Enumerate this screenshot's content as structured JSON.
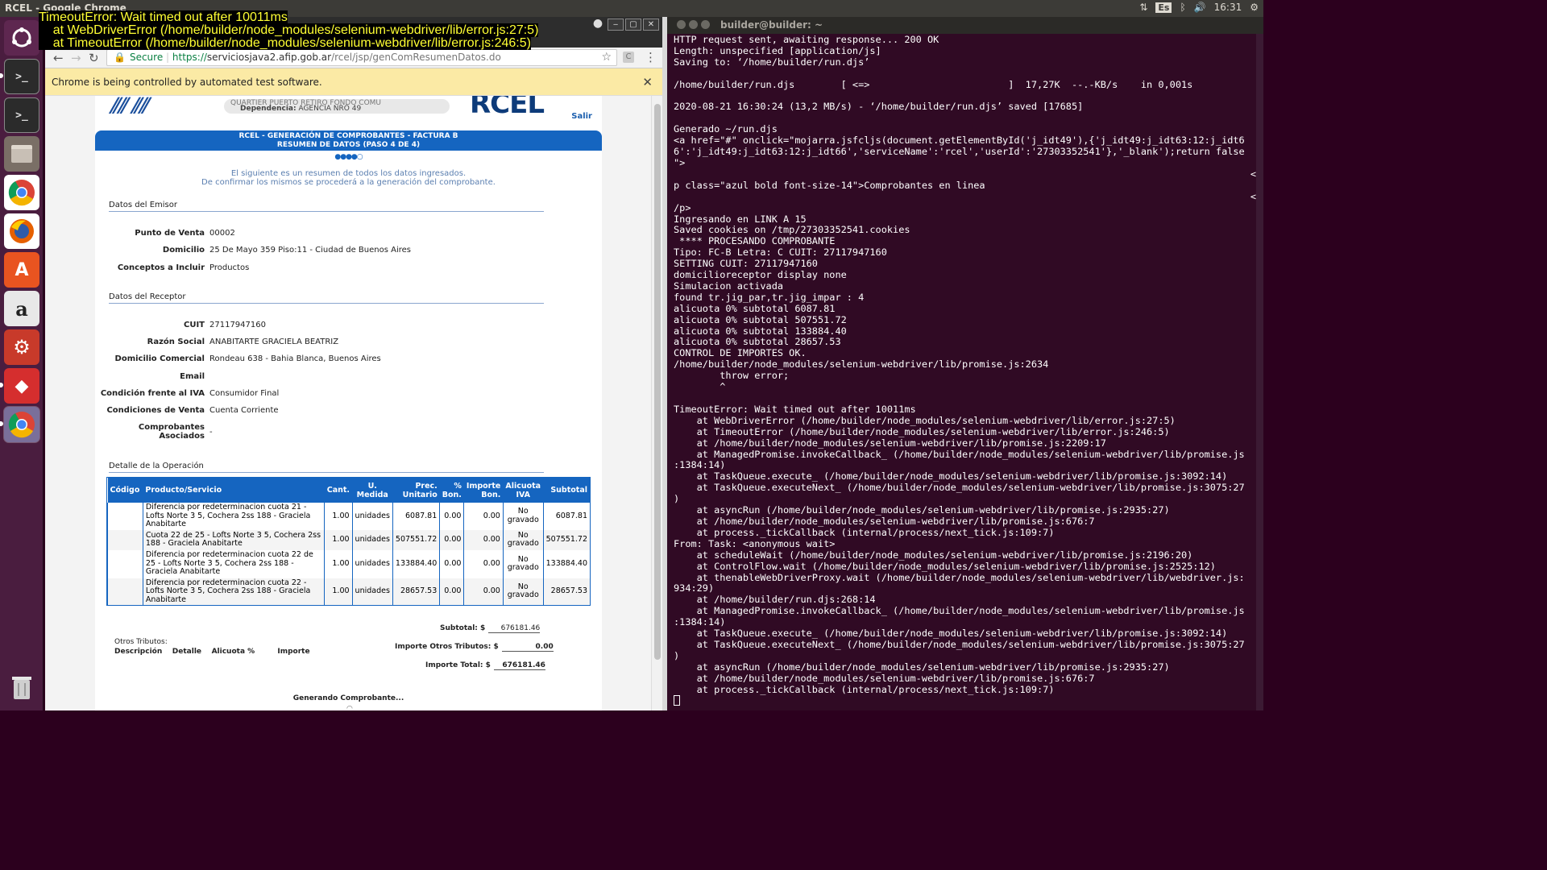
{
  "topbar": {
    "title": "RCEL - Google Chrome",
    "lang": "Es",
    "time": "16:31"
  },
  "error_overlay": [
    "TimeoutError: Wait timed out after 10011ms",
    "    at WebDriverError (/home/builder/node_modules/selenium-webdriver/lib/error.js:27:5)",
    "    at TimeoutError (/home/builder/node_modules/selenium-webdriver/lib/error.js:246:5)"
  ],
  "browser": {
    "secure_label": "Secure",
    "url_scheme": "https://",
    "url_host": "serviciosjava2.afip.gob.ar",
    "url_path": "/rcel/jsp/genComResumenDatos.do",
    "infobar": "Chrome is being controlled by automated test software."
  },
  "rcel": {
    "header_faded": "QUARTIER PUERTO RETIRO FONDO COMU",
    "dependencia_label": "Dependencia:",
    "dependencia": "AGENCIA NRO 49",
    "brand": "RCEL",
    "salir": "Salir",
    "band_title": "RCEL - GENERACIÓN DE COMPROBANTES - FACTURA B",
    "band_sub": "RESUMEN DE DATOS (PASO 4 DE 4)",
    "step_dots": "●●●●○",
    "intro_1": "El siguiente es un resumen de todos los datos ingresados.",
    "intro_2": "De confirmar los mismos se procederá a la generación del comprobante.",
    "emisor_title": "Datos del Emisor",
    "emisor": [
      {
        "label": "Punto de Venta",
        "value": "00002"
      },
      {
        "label": "Domicilio",
        "value": "25 De Mayo 359 Piso:11 - Ciudad de Buenos Aires"
      },
      {
        "label": "Conceptos a Incluir",
        "value": "Productos"
      }
    ],
    "receptor_title": "Datos del Receptor",
    "receptor": [
      {
        "label": "CUIT",
        "value": "27117947160"
      },
      {
        "label": "Razón Social",
        "value": "ANABITARTE GRACIELA BEATRIZ"
      },
      {
        "label": "Domicilio Comercial",
        "value": "Rondeau 638 - Bahia Blanca, Buenos Aires"
      },
      {
        "label": "Email",
        "value": ""
      },
      {
        "label": "Condición frente al IVA",
        "value": "Consumidor Final"
      },
      {
        "label": "Condiciones de Venta",
        "value": "Cuenta Corriente"
      }
    ],
    "asociados_label_1": "Comprobantes",
    "asociados_label_2": "Asociados",
    "asociados_value": "-",
    "detalle_title": "Detalle de la Operación",
    "columns": [
      "Código",
      "Producto/Servicio",
      "Cant.",
      "U. Medida",
      "Prec. Unitario",
      "% Bon.",
      "Importe Bon.",
      "Alicuota IVA",
      "Subtotal"
    ],
    "items": [
      {
        "codigo": "",
        "producto": "Diferencia por redeterminacion cuota 21 - Lofts Norte 3 5, Cochera 2ss 188 - Graciela Anabitarte",
        "cant": "1.00",
        "medida": "unidades",
        "precio": "6087.81",
        "bon": "0.00",
        "imp_bon": "0.00",
        "iva": "No gravado",
        "subtotal": "6087.81"
      },
      {
        "codigo": "",
        "producto": "Cuota 22 de 25 - Lofts Norte 3 5, Cochera 2ss 188 - Graciela Anabitarte",
        "cant": "1.00",
        "medida": "unidades",
        "precio": "507551.72",
        "bon": "0.00",
        "imp_bon": "0.00",
        "iva": "No gravado",
        "subtotal": "507551.72"
      },
      {
        "codigo": "",
        "producto": "Diferencia por redeterminacion cuota 22 de 25 - Lofts Norte 3 5, Cochera 2ss 188 - Graciela Anabitarte",
        "cant": "1.00",
        "medida": "unidades",
        "precio": "133884.40",
        "bon": "0.00",
        "imp_bon": "0.00",
        "iva": "No gravado",
        "subtotal": "133884.40"
      },
      {
        "codigo": "",
        "producto": "Diferencia por redeterminacion cuota 22 - Lofts Norte 3 5, Cochera 2ss 188 - Graciela Anabitarte",
        "cant": "1.00",
        "medida": "unidades",
        "precio": "28657.53",
        "bon": "0.00",
        "imp_bon": "0.00",
        "iva": "No gravado",
        "subtotal": "28657.53"
      }
    ],
    "subtotal_label": "Subtotal: $",
    "subtotal": "676181.46",
    "otros_tributos_title": "Otros Tributos:",
    "otros_cols": [
      "Descripción",
      "Detalle",
      "Alicuota %",
      "Importe"
    ],
    "otros_label": "Importe Otros Tributos: $",
    "otros_value": "0.00",
    "total_label": "Importe Total: $",
    "total": "676181.46",
    "generando": "Generando Comprobante..."
  },
  "terminal": {
    "title": "builder@builder: ~",
    "lines": [
      "HTTP request sent, awaiting response... 200 OK",
      "Length: unspecified [application/js]",
      "Saving to: ‘/home/builder/run.djs’",
      "",
      "/home/builder/run.djs        [ <=>                        ]  17,27K  --.-KB/s    in 0,001s",
      "",
      "2020-08-21 16:30:24 (13,2 MB/s) - ‘/home/builder/run.djs’ saved [17685]",
      "",
      "Generado ~/run.djs",
      "<a href=\"#\" onclick=\"mojarra.jsfcljs(document.getElementById('j_idt49'),{'j_idt49:j_idt63:12:j_idt6",
      "6':'j_idt49:j_idt63:12:j_idt66','serviceName':'rcel','userId':'27303352541'},'_blank');return false",
      "\">",
      "                                                                                                    <",
      "p class=\"azul bold font-size-14\">Comprobantes en linea",
      "                                                                                                    <",
      "/p>",
      "Ingresando en LINK A 15",
      "Saved cookies on /tmp/27303352541.cookies",
      " **** PROCESANDO COMPROBANTE",
      "Tipo: FC-B Letra: C CUIT: 27117947160",
      "SETTING CUIT: 27117947160",
      "domicilioreceptor display none",
      "Simulacion activada",
      "found tr.jig_par,tr.jig_impar : 4",
      "alicuota 0% subtotal 6087.81",
      "alicuota 0% subtotal 507551.72",
      "alicuota 0% subtotal 133884.40",
      "alicuota 0% subtotal 28657.53",
      "CONTROL DE IMPORTES OK.",
      "/home/builder/node_modules/selenium-webdriver/lib/promise.js:2634",
      "        throw error;",
      "        ^",
      "",
      "TimeoutError: Wait timed out after 10011ms",
      "    at WebDriverError (/home/builder/node_modules/selenium-webdriver/lib/error.js:27:5)",
      "    at TimeoutError (/home/builder/node_modules/selenium-webdriver/lib/error.js:246:5)",
      "    at /home/builder/node_modules/selenium-webdriver/lib/promise.js:2209:17",
      "    at ManagedPromise.invokeCallback_ (/home/builder/node_modules/selenium-webdriver/lib/promise.js",
      ":1384:14)",
      "    at TaskQueue.execute_ (/home/builder/node_modules/selenium-webdriver/lib/promise.js:3092:14)",
      "    at TaskQueue.executeNext_ (/home/builder/node_modules/selenium-webdriver/lib/promise.js:3075:27",
      ")",
      "    at asyncRun (/home/builder/node_modules/selenium-webdriver/lib/promise.js:2935:27)",
      "    at /home/builder/node_modules/selenium-webdriver/lib/promise.js:676:7",
      "    at process._tickCallback (internal/process/next_tick.js:109:7)",
      "From: Task: <anonymous wait>",
      "    at scheduleWait (/home/builder/node_modules/selenium-webdriver/lib/promise.js:2196:20)",
      "    at ControlFlow.wait (/home/builder/node_modules/selenium-webdriver/lib/promise.js:2525:12)",
      "    at thenableWebDriverProxy.wait (/home/builder/node_modules/selenium-webdriver/lib/webdriver.js:",
      "934:29)",
      "    at /home/builder/run.djs:268:14",
      "    at ManagedPromise.invokeCallback_ (/home/builder/node_modules/selenium-webdriver/lib/promise.js",
      ":1384:14)",
      "    at TaskQueue.execute_ (/home/builder/node_modules/selenium-webdriver/lib/promise.js:3092:14)",
      "    at TaskQueue.executeNext_ (/home/builder/node_modules/selenium-webdriver/lib/promise.js:3075:27",
      ")",
      "    at asyncRun (/home/builder/node_modules/selenium-webdriver/lib/promise.js:2935:27)",
      "    at /home/builder/node_modules/selenium-webdriver/lib/promise.js:676:7",
      "    at process._tickCallback (internal/process/next_tick.js:109:7)"
    ]
  }
}
